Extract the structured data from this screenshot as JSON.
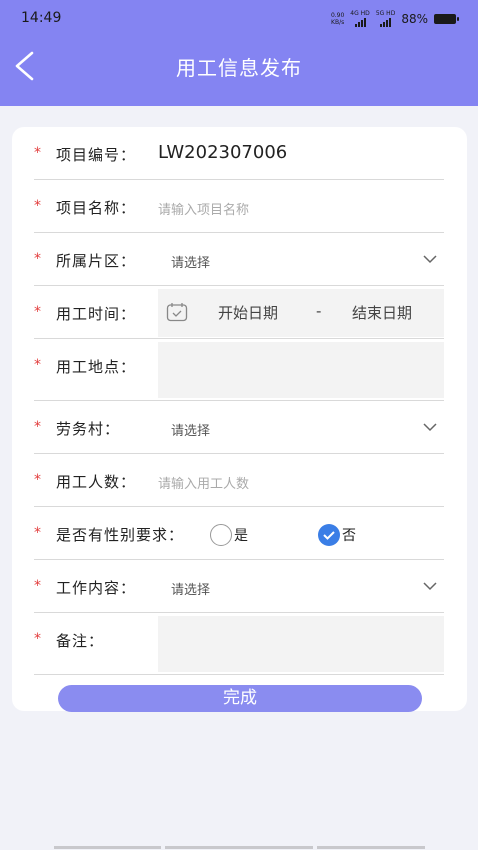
{
  "status": {
    "time": "14:49",
    "net_speed": "0.90\nKB/s",
    "net1": "4G HD",
    "net2": "5G HD",
    "battery": "88%"
  },
  "header": {
    "title": "用工信息发布"
  },
  "form": {
    "project_no": {
      "label": "项目编号：",
      "value": "LW202307006"
    },
    "project_name": {
      "label": "项目名称：",
      "placeholder": "请输入项目名称"
    },
    "area": {
      "label": "所属片区：",
      "value": "请选择"
    },
    "work_time": {
      "label": "用工时间：",
      "start": "开始日期",
      "dash": "-",
      "end": "结束日期"
    },
    "location": {
      "label": "用工地点："
    },
    "labor_village": {
      "label": "劳务村：",
      "value": "请选择"
    },
    "headcount": {
      "label": "用工人数：",
      "placeholder": "请输入用工人数"
    },
    "gender": {
      "label": "是否有性别要求：",
      "option_yes": "是",
      "option_no": "否",
      "selected": "否"
    },
    "content": {
      "label": "工作内容：",
      "value": "请选择"
    },
    "remark": {
      "label": "备注："
    },
    "required_mark": "*"
  },
  "submit_label": "完成",
  "colors": {
    "header": "#8484f2",
    "accent": "#3a7ee6",
    "required": "#e23c3c"
  }
}
